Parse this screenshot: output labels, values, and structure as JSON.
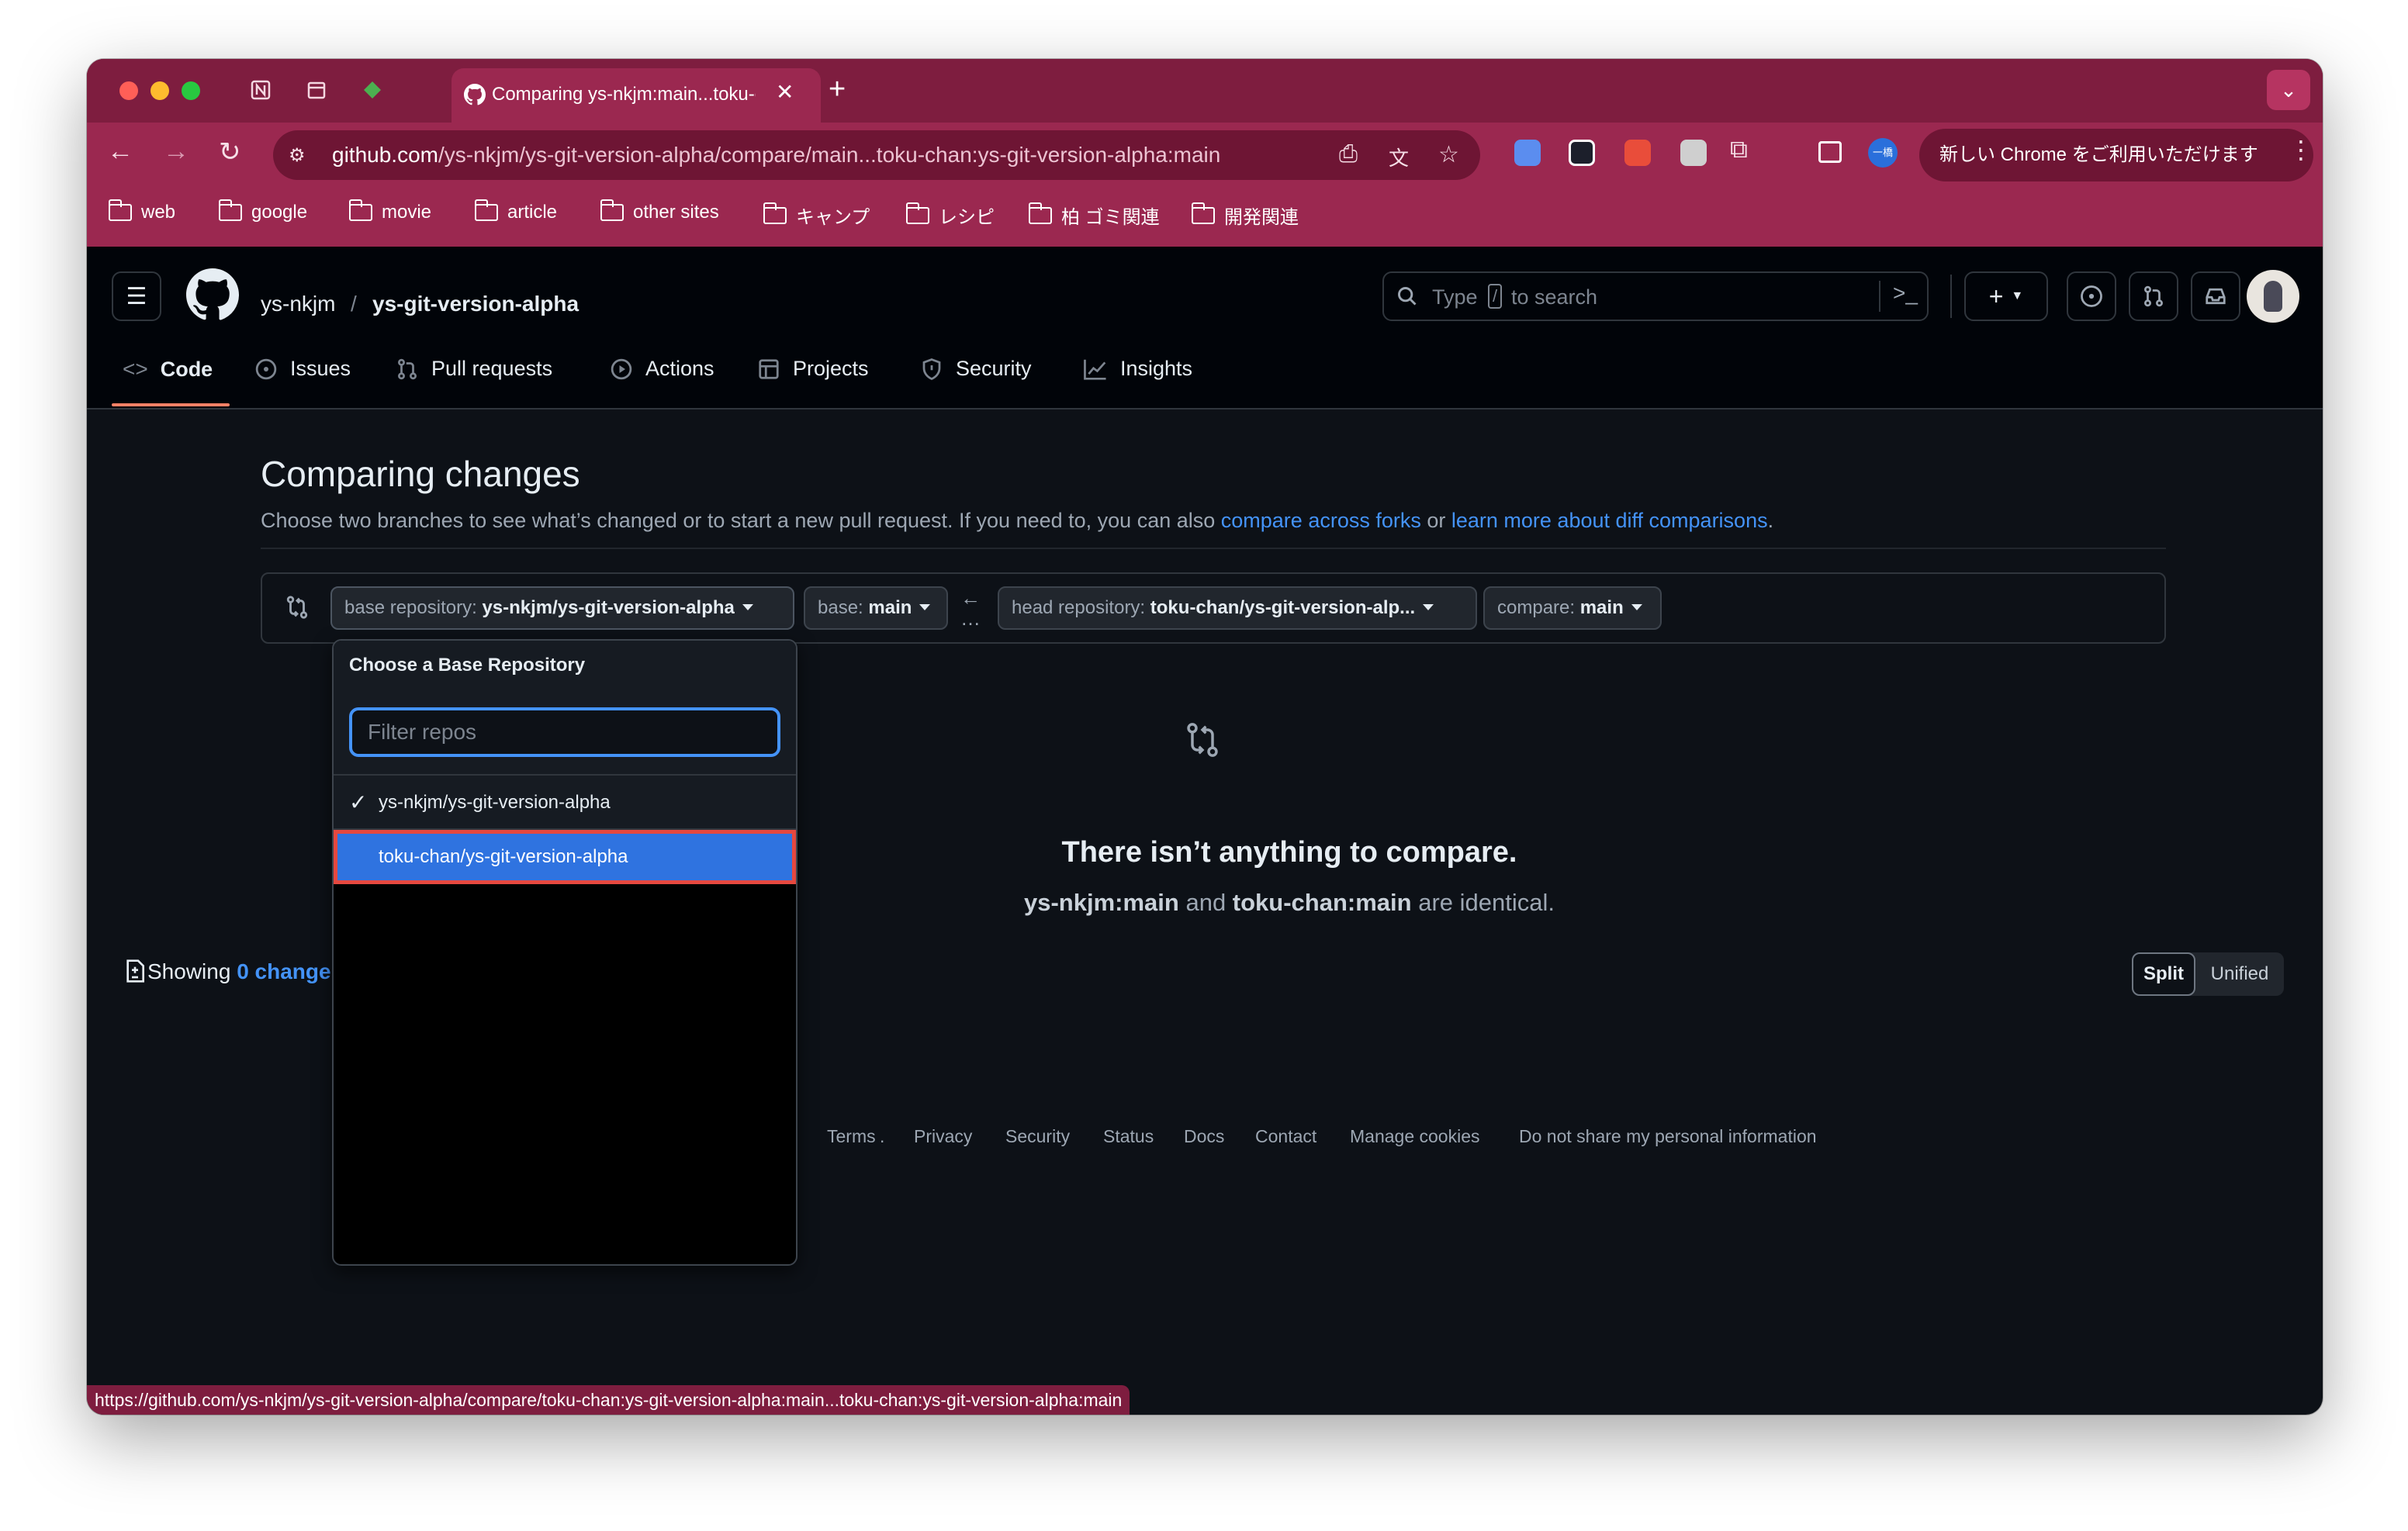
{
  "browser": {
    "active_tab_title": "Comparing ys-nkjm:main...toku-chan:ys-git-version-alpha:main",
    "url_host": "github.com",
    "url_path": "/ys-nkjm/ys-git-version-alpha/compare/main...toku-chan:ys-git-version-alpha:main",
    "promo_text": "新しい Chrome をご利用いただけます",
    "bookmarks": [
      "web",
      "google",
      "movie",
      "article",
      "other sites",
      "キャンプ",
      "レシピ",
      "柏 ゴミ関連",
      "開発関連"
    ],
    "status_url": "https://github.com/ys-nkjm/ys-git-version-alpha/compare/toku-chan:ys-git-version-alpha:main...toku-chan:ys-git-version-alpha:main",
    "accent_color": "#9b2850"
  },
  "repo": {
    "owner": "ys-nkjm",
    "separator": "/",
    "name": "ys-git-version-alpha"
  },
  "search": {
    "placeholder_before": "Type",
    "shortcut_key": "/",
    "placeholder_after": "to search"
  },
  "nav": {
    "tabs": [
      {
        "label": "Code",
        "icon": "code-icon"
      },
      {
        "label": "Issues",
        "icon": "issue-icon"
      },
      {
        "label": "Pull requests",
        "icon": "pull-request-icon"
      },
      {
        "label": "Actions",
        "icon": "play-icon"
      },
      {
        "label": "Projects",
        "icon": "table-icon"
      },
      {
        "label": "Security",
        "icon": "shield-icon"
      },
      {
        "label": "Insights",
        "icon": "graph-icon"
      }
    ],
    "selected": "Code"
  },
  "compare": {
    "title": "Comparing changes",
    "subtitle_text": "Choose two branches to see what’s changed or to start a new pull request. If you need to, you can also ",
    "link1": "compare across forks",
    "or_text": " or ",
    "link2": "learn more about diff comparisons",
    "period": ".",
    "base_repo_label": "base repository:",
    "base_repo_value": "ys-nkjm/ys-git-version-alpha",
    "base_label": "base:",
    "base_value": "main",
    "head_repo_label": "head repository:",
    "head_repo_value": "toku-chan/ys-git-version-alp...",
    "compare_label": "compare:",
    "compare_value": "main"
  },
  "blankslate": {
    "heading": "There isn’t anything to compare.",
    "ref1": "ys-nkjm:main",
    "and_text": " and ",
    "ref2": "toku-chan:main",
    "tail": " are identical."
  },
  "diff": {
    "showing_text": "Showing",
    "changes_link": "0 change",
    "split_label": "Split",
    "unified_label": "Unified"
  },
  "footer": {
    "links": [
      "Terms",
      "Privacy",
      "Security",
      "Status",
      "Docs",
      "Contact",
      "Manage cookies",
      "Do not share my personal information"
    ]
  },
  "dropdown": {
    "title": "Choose a Base Repository",
    "filter_placeholder": "Filter repos",
    "items": [
      {
        "label": "ys-nkjm/ys-git-version-alpha",
        "selected": true
      },
      {
        "label": "toku-chan/ys-git-version-alpha",
        "highlighted": true
      }
    ],
    "highlight_color": "#2f73e0",
    "highlight_border": "#e5483f"
  }
}
